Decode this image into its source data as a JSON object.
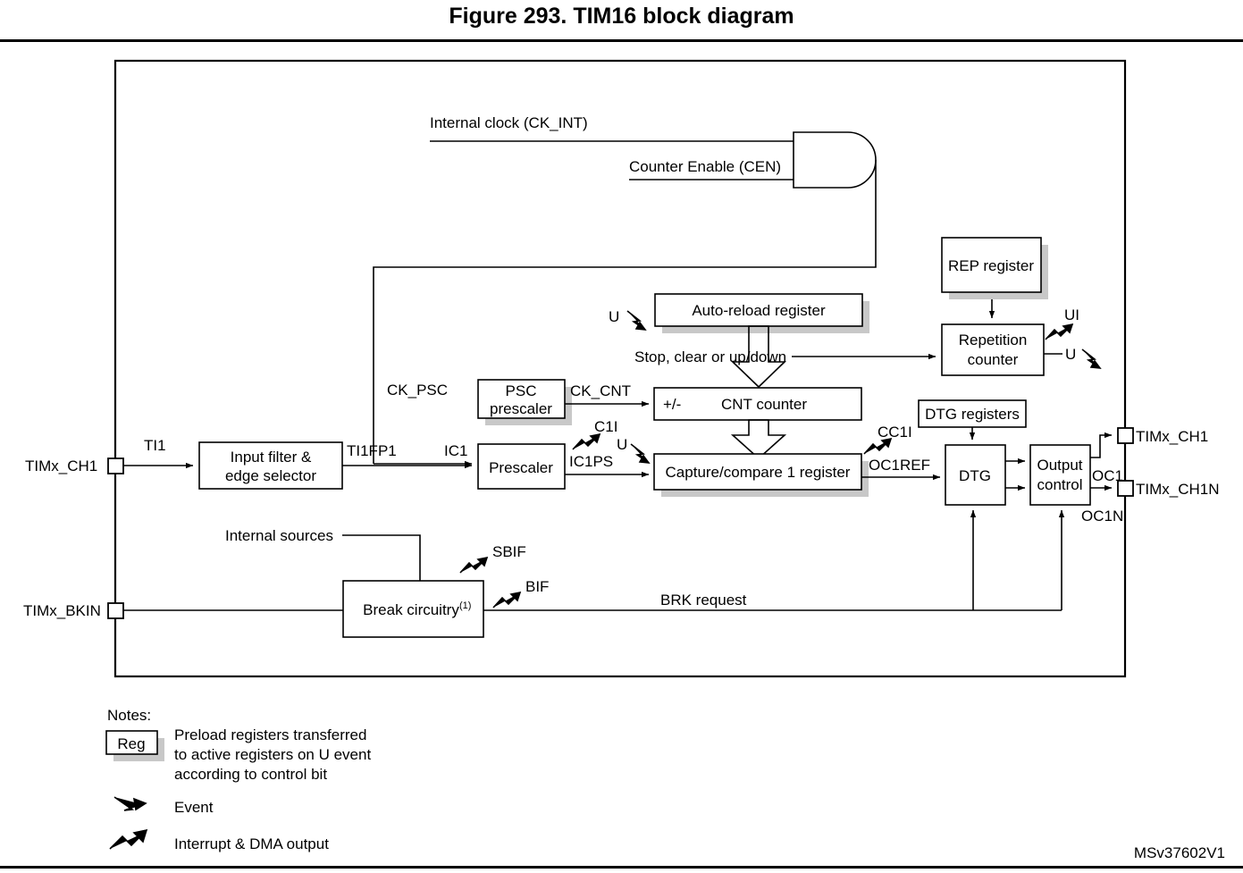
{
  "figure": {
    "title": "Figure 293. TIM16 block diagram",
    "watermark": "MSv37602V1"
  },
  "signals": {
    "internal_clock": "Internal clock (CK_INT)",
    "counter_enable": "Counter Enable (CEN)",
    "ck_psc": "CK_PSC",
    "ck_cnt": "CK_CNT",
    "stop_clear": "Stop, clear or up/down",
    "ti1": "TI1",
    "ti1fp1": "TI1FP1",
    "ic1": "IC1",
    "ic1ps": "IC1PS",
    "c1i": "C1I",
    "u_arr": "U",
    "u_arr2": "U",
    "u_rep": "U",
    "ui": "UI",
    "cc1i": "CC1I",
    "oc1ref": "OC1REF",
    "oc1": "OC1",
    "oc1n": "OC1N",
    "sbif": "SBIF",
    "bif": "BIF",
    "brk_request": "BRK request",
    "internal_sources": "Internal sources",
    "plus_minus": "+/-"
  },
  "pins": {
    "timx_ch1_in": "TIMx_CH1",
    "timx_bkin": "TIMx_BKIN",
    "timx_ch1_out": "TIMx_CH1",
    "timx_ch1n_out": "TIMx_CH1N"
  },
  "blocks": {
    "auto_reload": "Auto-reload register",
    "rep_register": "REP register",
    "repetition_counter_l1": "Repetition",
    "repetition_counter_l2": "counter",
    "psc_prescaler_l1": "PSC",
    "psc_prescaler_l2": "prescaler",
    "cnt_counter": "CNT counter",
    "capture_compare": "Capture/compare 1 register",
    "input_filter_l1": "Input filter &",
    "input_filter_l2": "edge selector",
    "prescaler": "Prescaler",
    "dtg_registers": "DTG registers",
    "dtg": "DTG",
    "output_control_l1": "Output",
    "output_control_l2": "control",
    "break_circuitry": "Break circuitry",
    "break_circuitry_note": "(1)"
  },
  "legend": {
    "heading": "Notes:",
    "reg_box_label": "Reg",
    "preload_line1": "Preload registers transferred",
    "preload_line2": "to active registers on U event",
    "preload_line3": "according to control bit",
    "event_label": "Event",
    "interrupt_label": "Interrupt & DMA output"
  },
  "colors": {
    "line": "#000000",
    "shadow": "#c8c8c8",
    "box_fill": "#ffffff",
    "background": "#ffffff"
  }
}
